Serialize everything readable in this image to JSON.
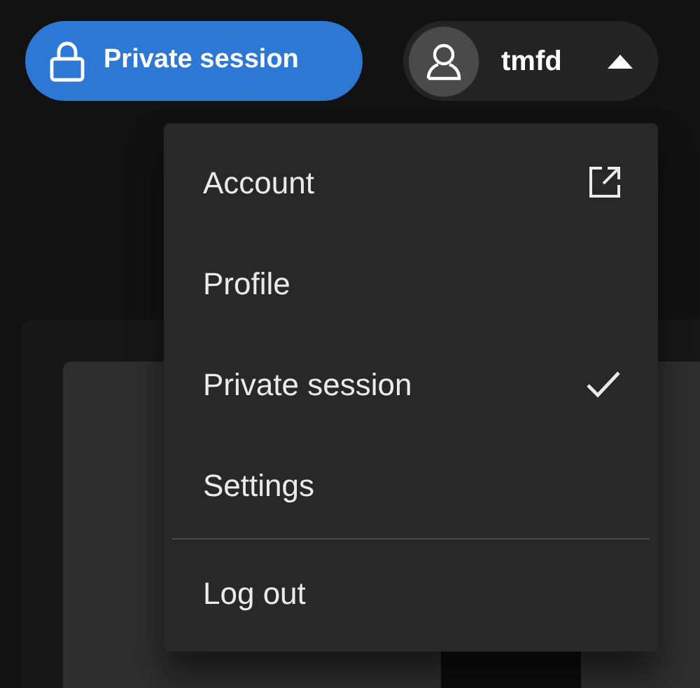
{
  "private_session_button": {
    "label": "Private session"
  },
  "user_button": {
    "username": "tmfd",
    "expanded": true
  },
  "menu": {
    "groups": [
      [
        {
          "label": "Account",
          "kind": "external"
        },
        {
          "label": "Profile",
          "kind": "plain"
        },
        {
          "label": "Private session",
          "kind": "toggle",
          "checked": true
        },
        {
          "label": "Settings",
          "kind": "plain"
        }
      ],
      [
        {
          "label": "Log out",
          "kind": "plain"
        }
      ]
    ]
  }
}
